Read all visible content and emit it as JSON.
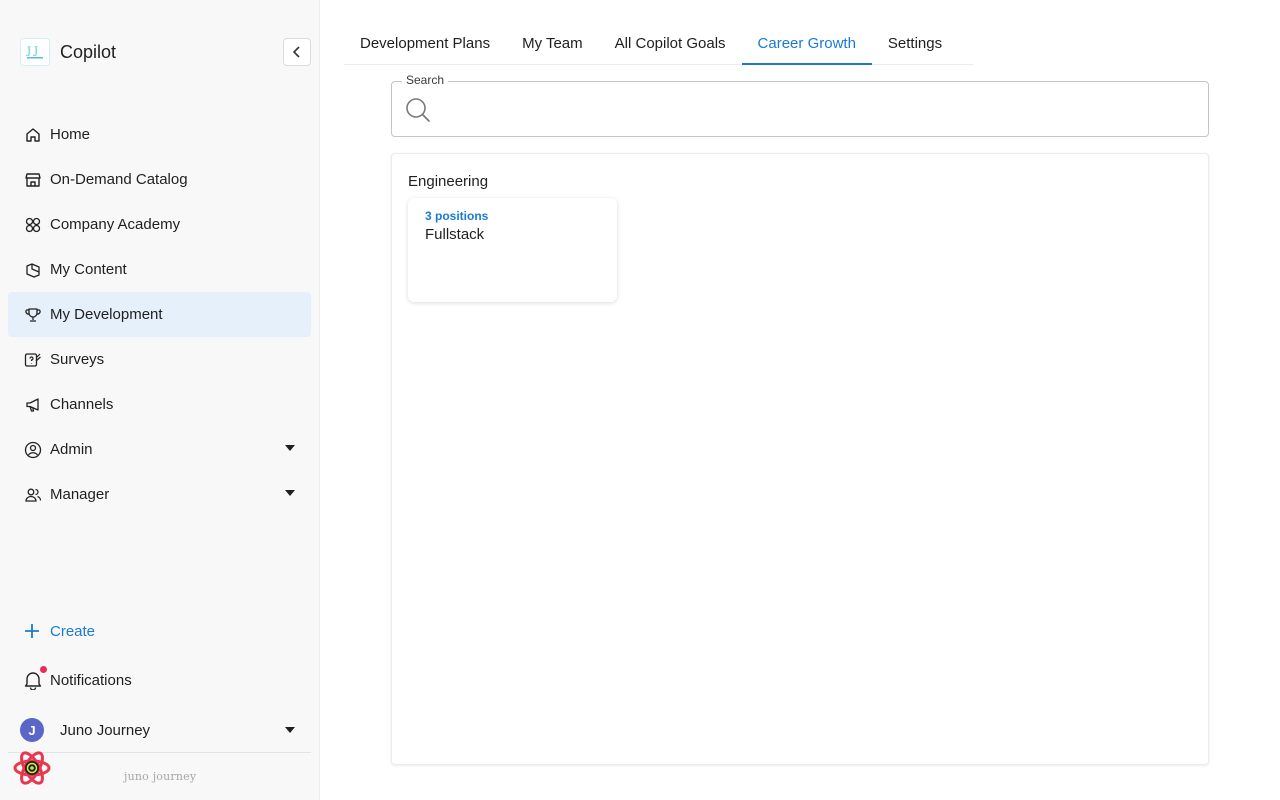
{
  "app": {
    "name": "Copilot"
  },
  "sidebar": {
    "items": [
      {
        "label": "Home",
        "icon": "home-icon"
      },
      {
        "label": "On-Demand Catalog",
        "icon": "store-icon"
      },
      {
        "label": "Company Academy",
        "icon": "grid-circles-icon"
      },
      {
        "label": "My Content",
        "icon": "folder-icon"
      },
      {
        "label": "My Development",
        "icon": "trophy-icon",
        "active": true
      },
      {
        "label": "Surveys",
        "icon": "survey-icon"
      },
      {
        "label": "Channels",
        "icon": "megaphone-icon"
      },
      {
        "label": "Admin",
        "icon": "user-circle-icon",
        "expandable": true
      },
      {
        "label": "Manager",
        "icon": "users-icon",
        "expandable": true
      }
    ],
    "create_label": "Create",
    "notifications_label": "Notifications",
    "user": {
      "initial": "J",
      "name": "Juno Journey"
    },
    "footer_brand": "juno journey"
  },
  "tabs": [
    {
      "label": "Development Plans"
    },
    {
      "label": "My Team"
    },
    {
      "label": "All Copilot Goals"
    },
    {
      "label": "Career Growth",
      "active": true
    },
    {
      "label": "Settings"
    }
  ],
  "search": {
    "label": "Search",
    "value": "",
    "placeholder": ""
  },
  "department": {
    "name": "Engineering",
    "cards": [
      {
        "count_label": "3 positions",
        "title": "Fullstack"
      }
    ]
  },
  "colors": {
    "accent": "#1a7ad1",
    "active_nav_bg": "#e6f0fa",
    "notification_dot": "#ef2a55",
    "avatar_bg": "#5a67c9"
  }
}
